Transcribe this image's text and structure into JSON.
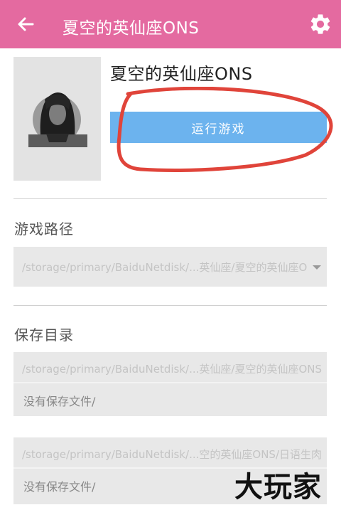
{
  "appbar": {
    "title": "夏空的英仙座ONS",
    "back_icon": "arrow-back-icon",
    "settings_icon": "gear-icon",
    "color": "#e46aa0"
  },
  "game": {
    "name": "夏空的英仙座ONS",
    "run_label": "运行游戏",
    "run_color": "#6cb3ee",
    "cover_icon": "character-portrait-icon"
  },
  "game_path": {
    "label": "游戏路径",
    "value": "/storage/primary/BaiduNetdisk/...英仙座/夏空的英仙座ONS"
  },
  "save_dir": {
    "label": "保存目录",
    "entries": [
      {
        "path": "/storage/primary/BaiduNetdisk/...英仙座/夏空的英仙座ONS",
        "status": "没有保存文件/"
      },
      {
        "path": "/storage/primary/BaiduNetdisk/...空的英仙座ONS/日语生肉",
        "status": "没有保存文件/"
      }
    ]
  },
  "watermark": "大玩家"
}
